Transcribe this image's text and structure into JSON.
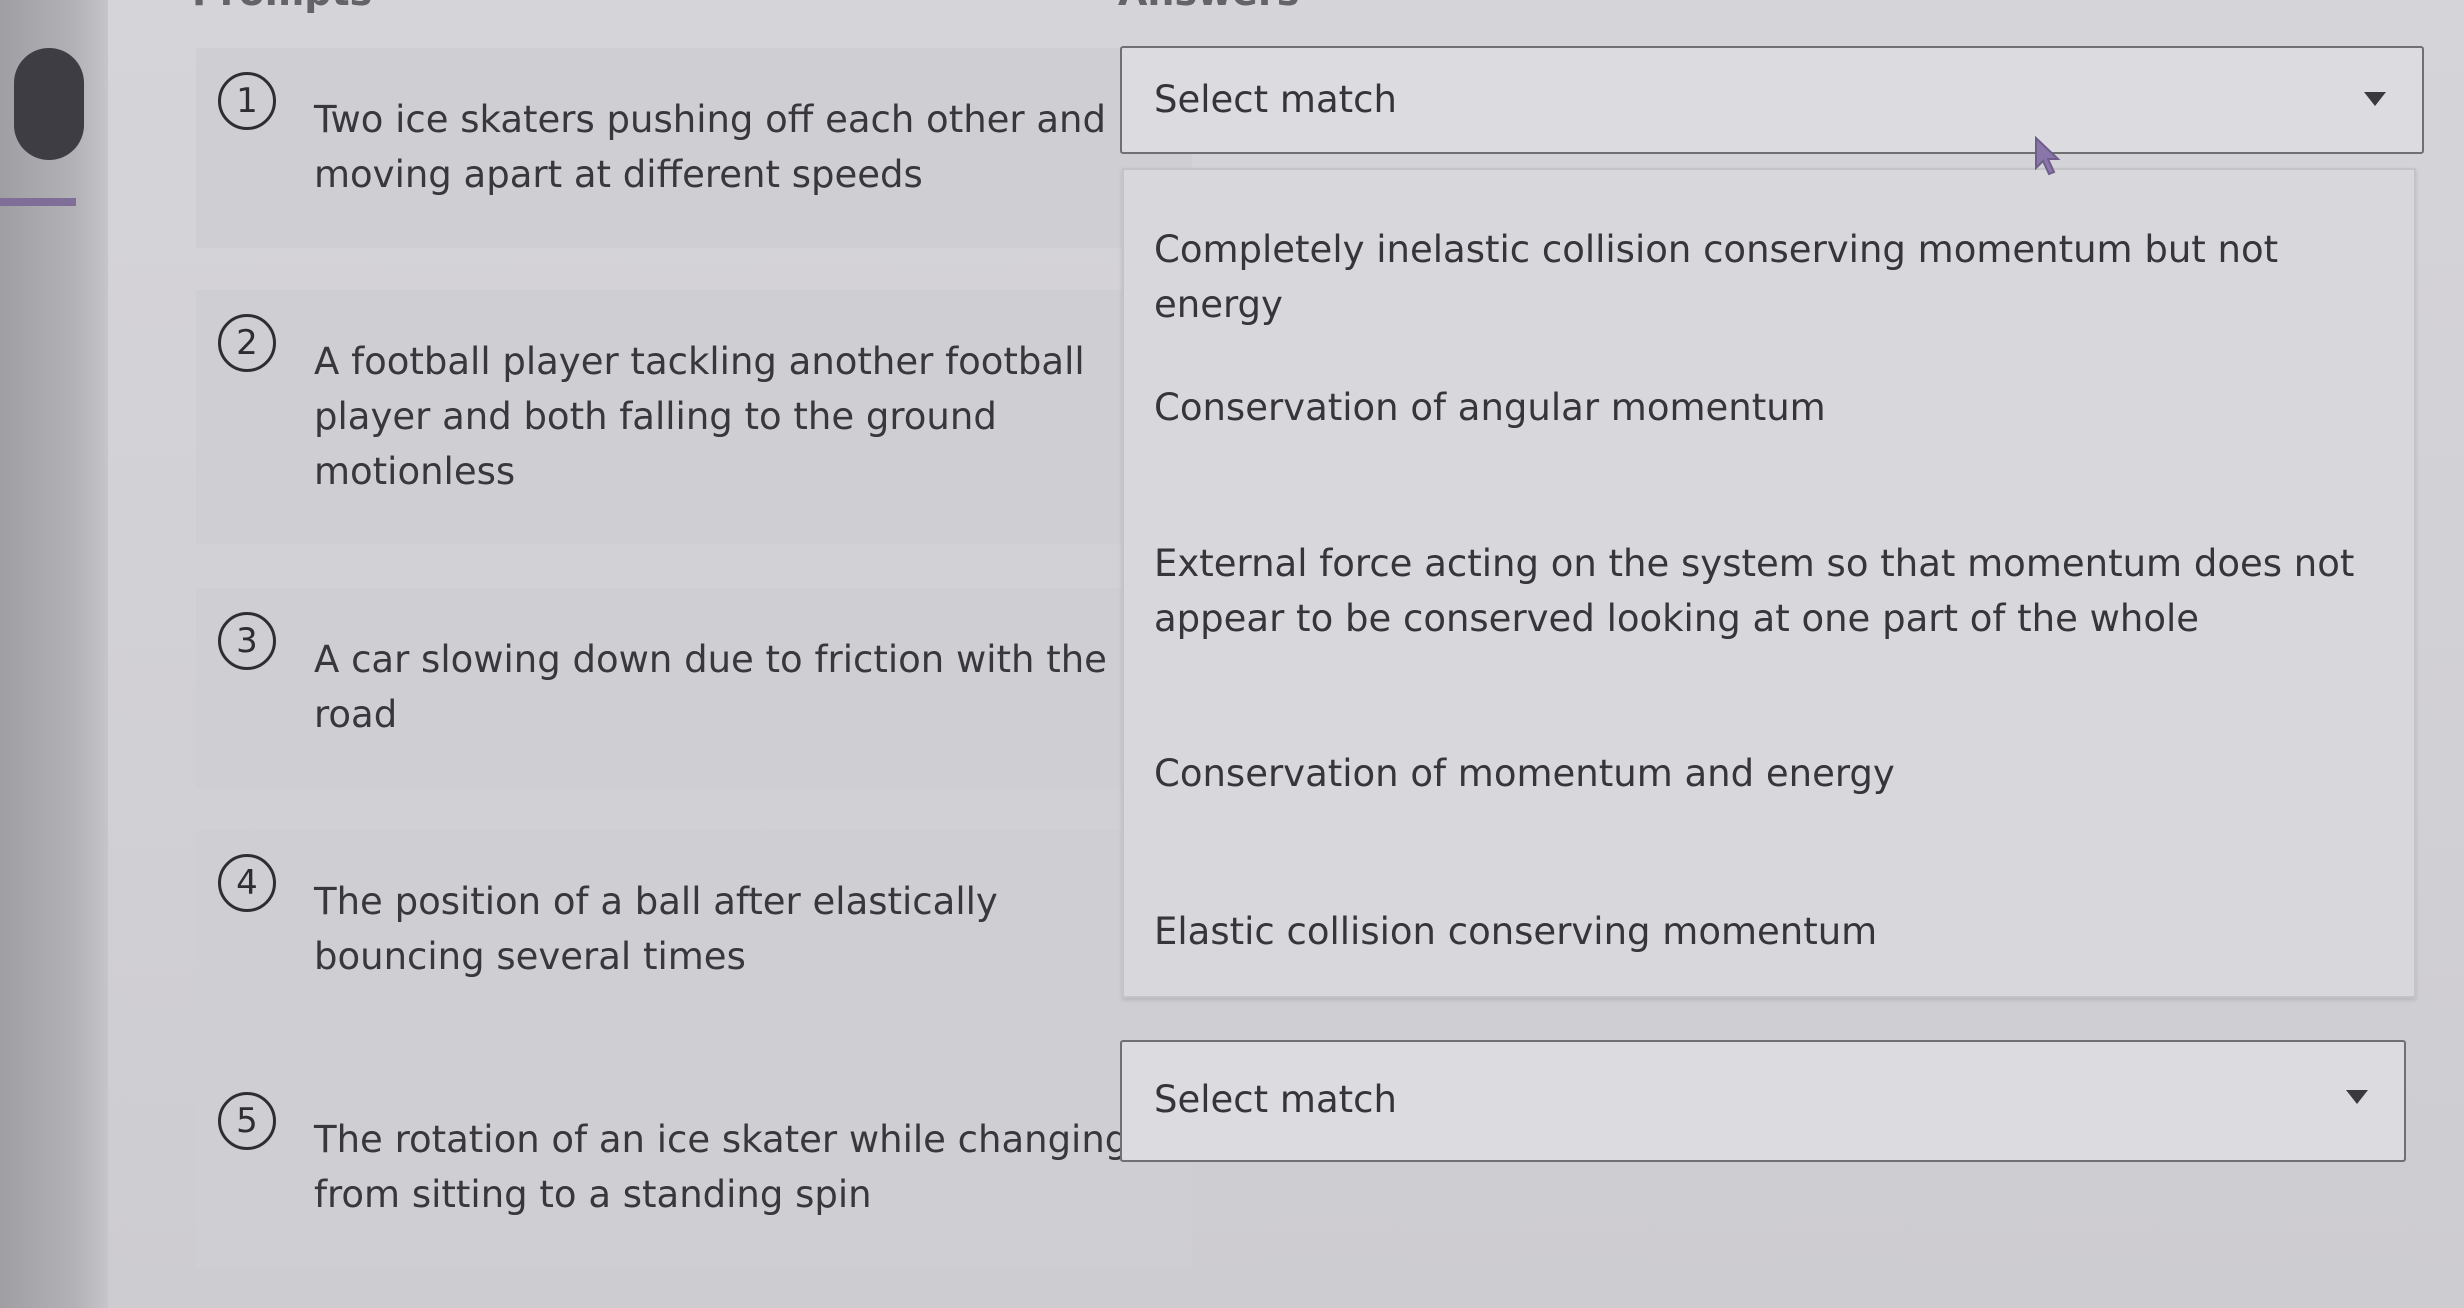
{
  "headings": {
    "prompts": "Prompts",
    "answers": "Answers"
  },
  "prompts": [
    {
      "number": "1",
      "text": "Two ice skaters pushing off each other and moving apart at different speeds"
    },
    {
      "number": "2",
      "text": "A football player tackling another football player and both falling to the ground motionless"
    },
    {
      "number": "3",
      "text": "A car slowing down due to friction with the road"
    },
    {
      "number": "4",
      "text": "The position of a ball after elastically bouncing several times"
    },
    {
      "number": "5",
      "text": "The rotation of an ice skater while changing from sitting to a standing spin"
    }
  ],
  "answers": {
    "select_1": "Select match",
    "select_5": "Select match",
    "options": [
      "Completely inelastic collision conserving momentum but not energy",
      "Conservation of angular momentum",
      "External force acting on the system so that momentum does not appear to be conserved looking at one part of the whole",
      "Conservation of momentum and energy",
      "Elastic collision conserving momentum"
    ]
  },
  "icons": {
    "dropdown": "chevron-down-icon",
    "pointer": "cursor-icon"
  }
}
